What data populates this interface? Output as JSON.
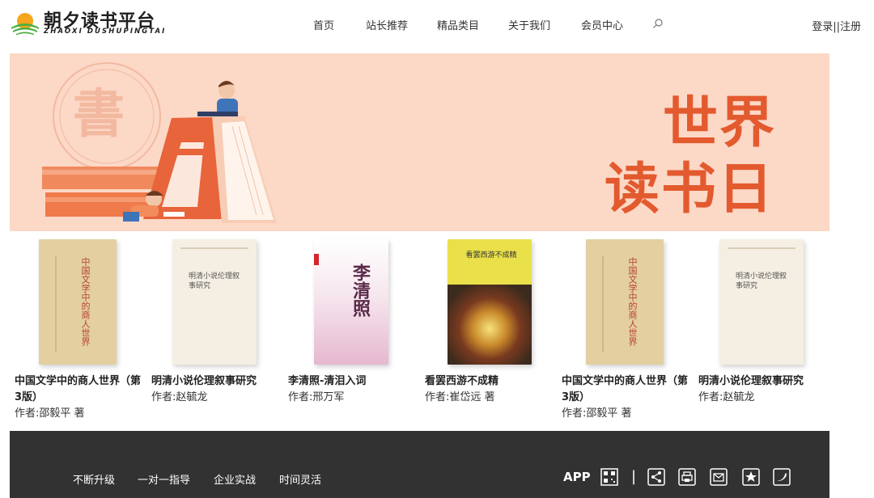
{
  "header": {
    "logo_title": "朝夕读书平台",
    "logo_subtitle": "ZHAOXI DUSHUPINGTAI",
    "nav": [
      "首页",
      "站长推荐",
      "精品类目",
      "关于我们",
      "会员中心"
    ],
    "login": "登录",
    "separator": "||",
    "register": "注册"
  },
  "banner": {
    "title_line1": "世界",
    "title_line2": "读书日",
    "seal_char": "書"
  },
  "books": [
    {
      "title": "中国文学中的商人世界（第3版）",
      "author": "作者:邵毅平 著",
      "cover_text": "中国文学中的商人世界"
    },
    {
      "title": "明清小说伦理叙事研究",
      "author": "作者:赵毓龙",
      "cover_text": "明清小说伦理叙事研究"
    },
    {
      "title": "李清照-清泪入词",
      "author": "作者:邢万军",
      "cover_text": "李清照"
    },
    {
      "title": "看罢西游不成精",
      "author": "作者:崔岱远 著",
      "cover_text": "看罢西游不成精"
    },
    {
      "title": "中国文学中的商人世界（第3版）",
      "author": "作者:邵毅平 著",
      "cover_text": "中国文学中的商人世界"
    },
    {
      "title": "明清小说伦理叙事研究",
      "author": "作者:赵毓龙",
      "cover_text": "明清小说伦理叙事研究"
    }
  ],
  "footer": {
    "links": [
      "不断升级",
      "一对一指导",
      "企业实战",
      "时间灵活"
    ],
    "app_label": "APP",
    "separator": "|",
    "icons": [
      "qrcode-icon",
      "share-icon",
      "print-icon",
      "mail-icon",
      "star-icon",
      "twitter-icon"
    ]
  },
  "colors": {
    "banner_bg": "#fcd8c6",
    "banner_accent": "#e35a2f",
    "footer_bg": "#323232"
  }
}
